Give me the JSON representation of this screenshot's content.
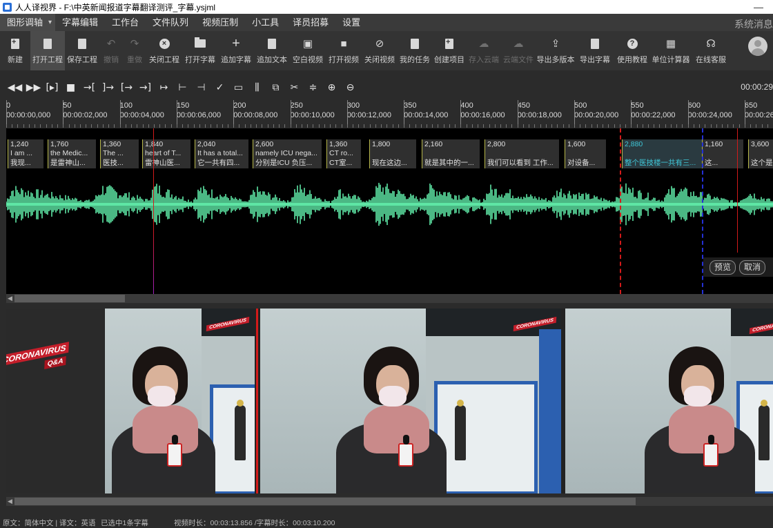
{
  "window": {
    "title": "人人译视界 - F:\\中英新闻报道字幕翻译测评_字幕.ysjml"
  },
  "menu": {
    "items": [
      "图形调轴",
      "字幕编辑",
      "工作台",
      "文件队列",
      "视频压制",
      "小工具",
      "译员招募",
      "设置"
    ],
    "system_message": "系统消息"
  },
  "toolbar": {
    "tools": [
      {
        "label": "新建",
        "icon": "new-file-icon"
      },
      {
        "label": "打开工程",
        "icon": "open-project-icon"
      },
      {
        "label": "保存工程",
        "icon": "save-icon"
      },
      {
        "label": "撤销",
        "icon": "undo-icon"
      },
      {
        "label": "重做",
        "icon": "redo-icon"
      },
      {
        "label": "关闭工程",
        "icon": "close-project-icon"
      },
      {
        "label": "打开字幕",
        "icon": "open-subtitle-icon"
      },
      {
        "label": "追加字幕",
        "icon": "append-subtitle-icon"
      },
      {
        "label": "追加文本",
        "icon": "append-text-icon"
      },
      {
        "label": "空白视频",
        "icon": "blank-video-icon"
      },
      {
        "label": "打开视频",
        "icon": "open-video-icon"
      },
      {
        "label": "关闭视频",
        "icon": "close-video-icon"
      },
      {
        "label": "我的任务",
        "icon": "task-icon"
      },
      {
        "label": "创建项目",
        "icon": "create-project-icon"
      },
      {
        "label": "存入云端",
        "icon": "cloud-upload-icon"
      },
      {
        "label": "云端文件",
        "icon": "cloud-file-icon"
      },
      {
        "label": "导出多版本",
        "icon": "export-versions-icon"
      },
      {
        "label": "导出字幕",
        "icon": "export-subtitle-icon"
      },
      {
        "label": "使用教程",
        "icon": "help-icon"
      },
      {
        "label": "单位计算器",
        "icon": "calculator-icon"
      },
      {
        "label": "在线客服",
        "icon": "headset-icon"
      }
    ]
  },
  "controls": {
    "time_display": "00:00:29"
  },
  "ruler": {
    "frame_labels": [
      "0",
      "50",
      "100",
      "150",
      "200",
      "250",
      "300",
      "350",
      "400",
      "450",
      "500",
      "550",
      "600",
      "650"
    ],
    "time_labels": [
      "00:00:00,000",
      "00:00:02,000",
      "00:00:04,000",
      "00:00:06,000",
      "00:00:08,000",
      "00:00:10,000",
      "00:00:12,000",
      "00:00:14,000",
      "00:00:16,000",
      "00:00:18,000",
      "00:00:20,000",
      "00:00:22,000",
      "00:00:24,000",
      "00:00:26,0"
    ]
  },
  "subtitles": [
    {
      "dur": "1,240",
      "en": "I am ...",
      "zh": "我现..."
    },
    {
      "dur": "1,760",
      "en": "the Medic...",
      "zh": "是雷神山..."
    },
    {
      "dur": "1,360",
      "en": "The ...",
      "zh": "医技..."
    },
    {
      "dur": "1,840",
      "en": "heart of T...",
      "zh": "雷神山医..."
    },
    {
      "dur": "2,040",
      "en": "It has a total...",
      "zh": "它一共有四..."
    },
    {
      "dur": "2,600",
      "en": "namely ICU nega...",
      "zh": "分别是ICU 负压..."
    },
    {
      "dur": "1,360",
      "en": "CT ro...",
      "zh": "CT室..."
    },
    {
      "dur": "1,800",
      "en": "",
      "zh": "现在这边..."
    },
    {
      "dur": "2,160",
      "en": "",
      "zh": "就是其中的一..."
    },
    {
      "dur": "2,800",
      "en": "",
      "zh": "我们可以看到 工作..."
    },
    {
      "dur": "1,600",
      "en": "",
      "zh": "对设备..."
    },
    {
      "dur": "2,880",
      "en": "",
      "zh": "整个医技楼一共有三..."
    },
    {
      "dur": "1,160",
      "en": "",
      "zh": "这..."
    },
    {
      "dur": "3,600",
      "en": "",
      "zh": "这个是"
    }
  ],
  "preview_buttons": {
    "preview": "预览",
    "cancel": "取消"
  },
  "video": {
    "badge_text": "CORONAVIRUS",
    "badge_sub": "Q&A"
  },
  "status": {
    "language": "原文：简体中文 | 译文：英语",
    "selection": "已选中1条字幕",
    "durations": "视频时长：00:03:13.856 /字幕时长：00:03:10.200"
  },
  "colors": {
    "waveform": "#5ee6a5",
    "highlight_text": "#3fc7d8",
    "playhead_red": "#d31a1a",
    "marker_blue": "#2430d6"
  }
}
